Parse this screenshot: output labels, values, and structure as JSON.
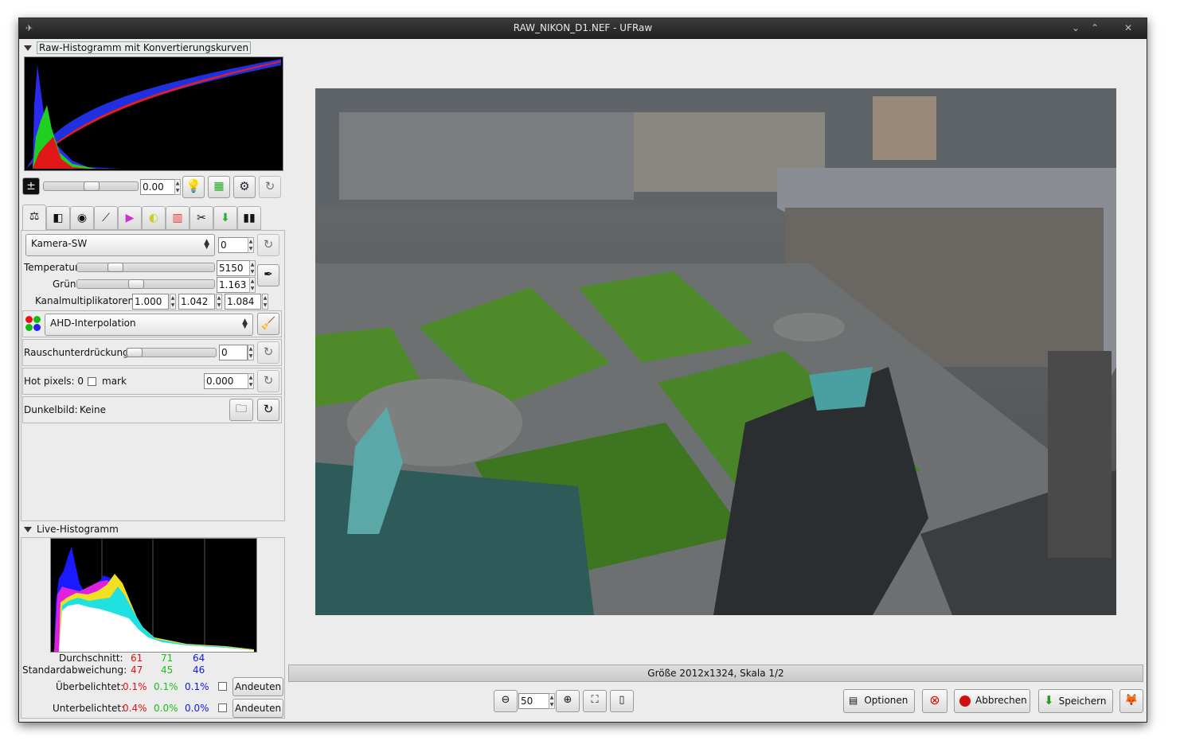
{
  "window": {
    "title": "RAW_NIKON_D1.NEF - UFRaw"
  },
  "raw_histogram": {
    "label": "Raw-Histogramm mit Konvertierungskurven"
  },
  "exposure": {
    "value": "0.00"
  },
  "whitebalance": {
    "preset": "Kamera-SW",
    "fine_tune": "0",
    "temperature_label": "Temperatur",
    "temperature": "5150",
    "green_label": "Grün",
    "green": "1.163",
    "channel_label": "Kanalmultiplikatoren:",
    "mult_r": "1.000",
    "mult_g": "1.042",
    "mult_b": "1.084"
  },
  "interpolation": {
    "value": "AHD-Interpolation"
  },
  "denoise": {
    "label": "Rauschunterdrückung",
    "value": "0"
  },
  "hotpixels": {
    "label": "Hot pixels: 0",
    "mark_label": "mark",
    "value": "0.000"
  },
  "darkframe": {
    "label": "Dunkelbild:",
    "value": "Keine"
  },
  "live_histogram": {
    "label": "Live-Histogramm",
    "avg_label": "Durchschnitt:",
    "avg": [
      "61",
      "71",
      "64"
    ],
    "std_label": "Standardabweichung:",
    "std": [
      "47",
      "45",
      "46"
    ],
    "over_label": "Überbelichtet:",
    "over": [
      "0.1%",
      "0.1%",
      "0.1%"
    ],
    "under_label": "Unterbelichtet:",
    "under": [
      "0.4%",
      "0.0%",
      "0.0%"
    ],
    "indicate_label": "Andeuten"
  },
  "status": {
    "text": "Größe 2012x1324, Skala 1/2"
  },
  "zoom": {
    "value": "50"
  },
  "actions": {
    "options": "Optionen",
    "cancel": "Abbrechen",
    "save": "Speichern"
  },
  "colors": {
    "titlebar": "#2a2a2a",
    "panel": "#ececec",
    "histogram_bg": "#000000"
  }
}
